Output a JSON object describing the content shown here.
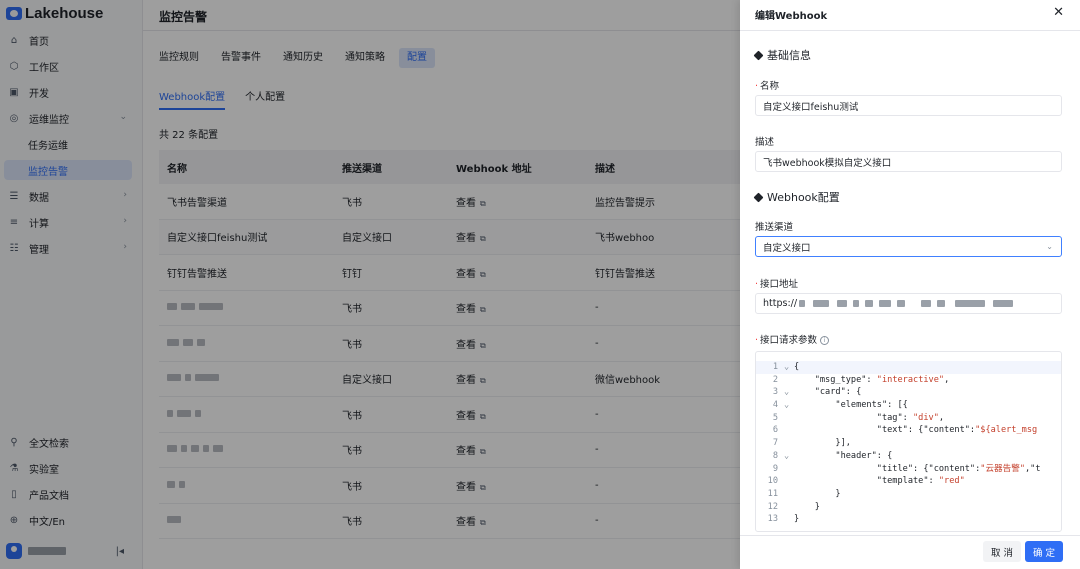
{
  "brand": {
    "name": "Lakehouse"
  },
  "sidebar": {
    "items": [
      {
        "label": "首页",
        "icon": "home-icon"
      },
      {
        "label": "工作区",
        "icon": "box-icon"
      },
      {
        "label": "开发",
        "icon": "code-icon"
      },
      {
        "label": "运维监控",
        "icon": "monitor-icon"
      },
      {
        "label": "任务运维"
      },
      {
        "label": "监控告警"
      },
      {
        "label": "数据",
        "icon": "database-icon"
      },
      {
        "label": "计算",
        "icon": "compute-icon"
      },
      {
        "label": "管理",
        "icon": "manage-icon"
      }
    ],
    "bottom_items": [
      {
        "label": "全文检索",
        "icon": "search-icon"
      },
      {
        "label": "实验室",
        "icon": "flask-icon"
      },
      {
        "label": "产品文档",
        "icon": "book-icon"
      },
      {
        "label": "中文/En",
        "icon": "globe-icon"
      }
    ]
  },
  "main": {
    "title": "监控告警",
    "tabs": [
      "监控规则",
      "告警事件",
      "通知历史",
      "通知策略",
      "配置"
    ],
    "subtabs": [
      "Webhook配置",
      "个人配置"
    ],
    "count_text": "共 22 条配置",
    "columns": [
      "名称",
      "推送渠道",
      "Webhook 地址",
      "描述"
    ],
    "view_label": "查看",
    "rows": [
      {
        "name": "飞书告警渠道",
        "channel": "飞书",
        "desc": "监控告警提示"
      },
      {
        "name": "自定义接口feishu测试",
        "channel": "自定义接口",
        "desc": "飞书webhoo"
      },
      {
        "name": "钉钉告警推送",
        "channel": "钉钉",
        "desc": "钉钉告警推送"
      },
      {
        "name": "",
        "channel": "飞书",
        "desc": "-"
      },
      {
        "name": "",
        "channel": "飞书",
        "desc": "-"
      },
      {
        "name": "",
        "channel": "自定义接口",
        "desc": "微信webhook"
      },
      {
        "name": "",
        "channel": "飞书",
        "desc": "-"
      },
      {
        "name": "",
        "channel": "飞书",
        "desc": "-"
      },
      {
        "name": "",
        "channel": "飞书",
        "desc": "-"
      },
      {
        "name": "",
        "channel": "飞书",
        "desc": "-"
      }
    ]
  },
  "drawer": {
    "title": "编辑Webhook",
    "section_basic": "基础信息",
    "name_label": "名称",
    "name_value": "自定义接口feishu测试",
    "desc_label": "描述",
    "desc_value": "飞书webhook模拟自定义接口",
    "section_webhook": "Webhook配置",
    "channel_label": "推送渠道",
    "channel_value": "自定义接口",
    "url_label": "接口地址",
    "url_value": "https://",
    "params_label": "接口请求参数",
    "code_lines": [
      {
        "n": "1",
        "fold": "⌄",
        "parts": [
          [
            "ct",
            "{"
          ]
        ]
      },
      {
        "n": "2",
        "fold": "",
        "parts": [
          [
            "ct",
            "    \"msg_type\": "
          ],
          [
            "str",
            "\"interactive\""
          ],
          [
            "ct",
            ","
          ]
        ]
      },
      {
        "n": "3",
        "fold": "⌄",
        "parts": [
          [
            "ct",
            "    \"card\": {"
          ]
        ]
      },
      {
        "n": "4",
        "fold": "⌄",
        "parts": [
          [
            "ct",
            "        \"elements\": [{"
          ]
        ]
      },
      {
        "n": "5",
        "fold": "",
        "parts": [
          [
            "ct",
            "                \"tag\": "
          ],
          [
            "str",
            "\"div\""
          ],
          [
            "ct",
            ","
          ]
        ]
      },
      {
        "n": "6",
        "fold": "",
        "parts": [
          [
            "ct",
            "                \"text\": {\"content\":"
          ],
          [
            "str",
            "\"${alert_msg"
          ]
        ]
      },
      {
        "n": "7",
        "fold": "",
        "parts": [
          [
            "ct",
            "        }],"
          ]
        ]
      },
      {
        "n": "8",
        "fold": "⌄",
        "parts": [
          [
            "ct",
            "        \"header\": {"
          ]
        ]
      },
      {
        "n": "9",
        "fold": "",
        "parts": [
          [
            "ct",
            "                \"title\": {\"content\":"
          ],
          [
            "str",
            "\"云器告警\""
          ],
          [
            "ct",
            ",\"t"
          ]
        ]
      },
      {
        "n": "10",
        "fold": "",
        "parts": [
          [
            "ct",
            "                \"template\": "
          ],
          [
            "str",
            "\"red\""
          ]
        ]
      },
      {
        "n": "11",
        "fold": "",
        "parts": [
          [
            "ct",
            "        }"
          ]
        ]
      },
      {
        "n": "12",
        "fold": "",
        "parts": [
          [
            "ct",
            "    }"
          ]
        ]
      },
      {
        "n": "13",
        "fold": "",
        "parts": [
          [
            "ct",
            "}"
          ]
        ]
      }
    ],
    "cancel_label": "取 消",
    "ok_label": "确 定"
  },
  "colors": {
    "accent": "#2f6ef5",
    "string": "#c4402c",
    "required": "#f53f3f"
  }
}
